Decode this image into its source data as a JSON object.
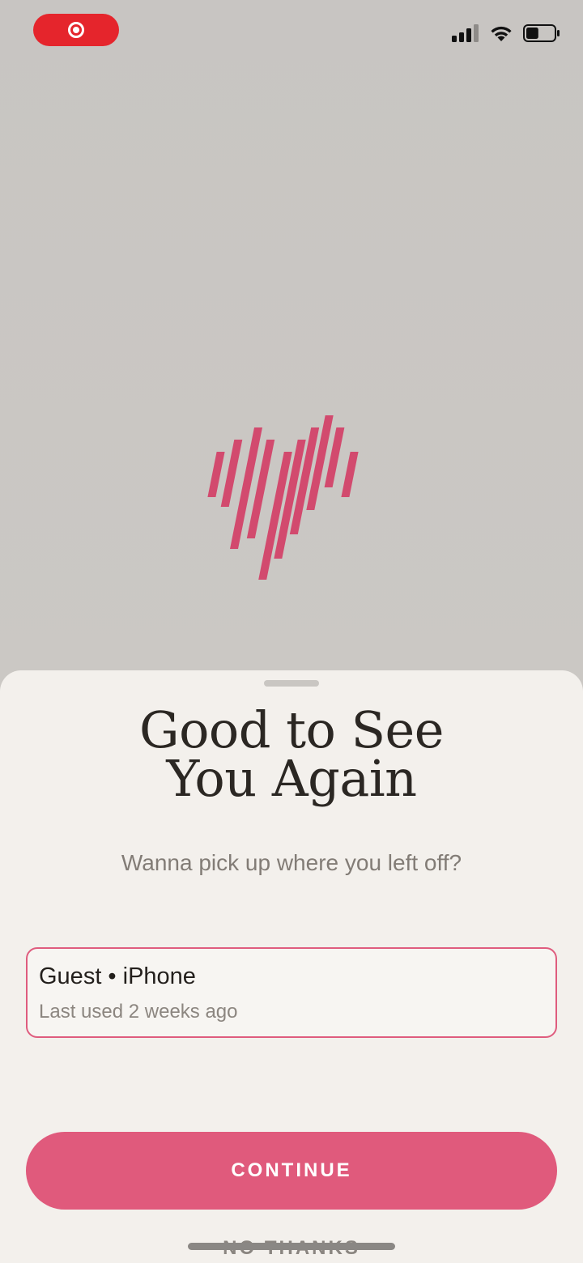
{
  "status_bar": {
    "recording_icon": "screen-record-icon",
    "signal_icon": "cellular-signal-icon",
    "wifi_icon": "wifi-icon",
    "battery_icon": "battery-icon",
    "battery_level": 0.45
  },
  "logo": {
    "icon": "striped-heart-logo-icon",
    "color": "#d24a6e"
  },
  "sheet": {
    "title_line1": "Good to See",
    "title_line2": "You Again",
    "subtitle": "Wanna pick up where you left off?",
    "account": {
      "name": "Guest • iPhone",
      "last_used": "Last used 2 weeks ago"
    },
    "continue_label": "CONTINUE",
    "no_thanks_label": "NO THANKS"
  },
  "colors": {
    "accent": "#e05a7c",
    "card_border": "#df5c7e",
    "recording": "#e5252c"
  }
}
